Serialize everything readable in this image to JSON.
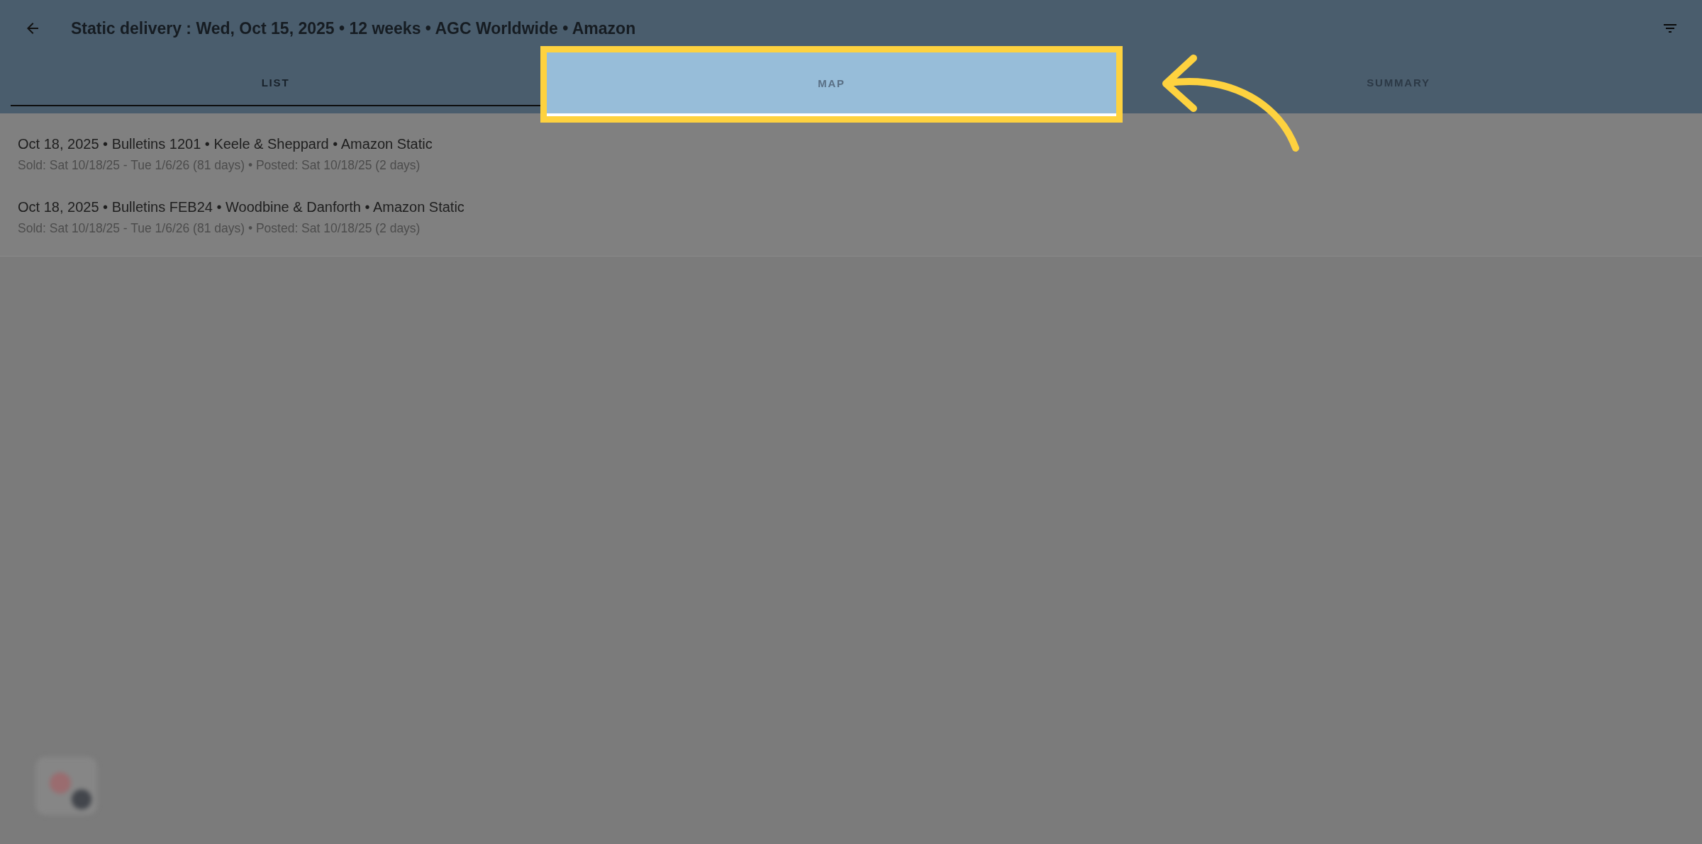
{
  "header": {
    "title": "Static delivery : Wed, Oct 15, 2025 • 12 weeks • AGC Worldwide • Amazon"
  },
  "tabs": [
    {
      "label": "LIST",
      "selected": true,
      "highlighted": false
    },
    {
      "label": "MAP",
      "selected": false,
      "highlighted": true
    },
    {
      "label": "SUMMARY",
      "selected": false,
      "highlighted": false
    }
  ],
  "rows": [
    {
      "title": "Oct 18, 2025 • Bulletins 1201 • Keele & Sheppard • Amazon Static",
      "details": "Sold: Sat 10/18/25 - Tue 1/6/26 (81 days) • Posted: Sat 10/18/25 (2 days)"
    },
    {
      "title": "Oct 18, 2025 • Bulletins FEB24 • Woodbine & Danforth • Amazon Static",
      "details": "Sold: Sat 10/18/25 - Tue 1/6/26 (81 days) • Posted: Sat 10/18/25 (2 days)"
    }
  ]
}
